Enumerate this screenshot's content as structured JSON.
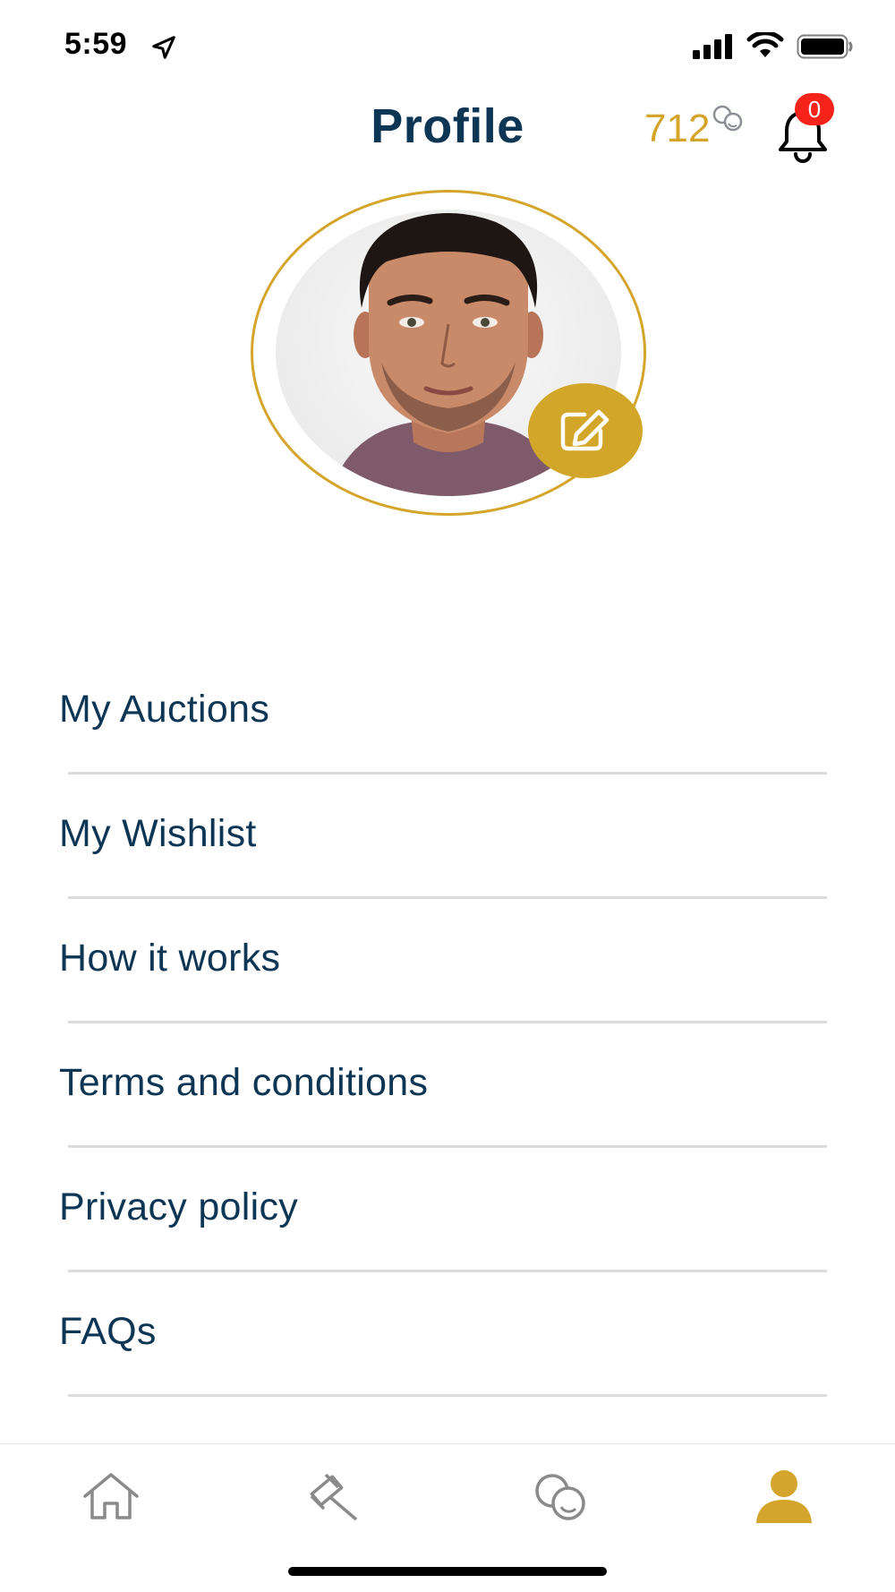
{
  "status_bar": {
    "time": "5:59"
  },
  "header": {
    "title": "Profile",
    "coins": "712",
    "notification_count": "0"
  },
  "colors": {
    "accent_gold": "#d4a52a",
    "title_navy": "#0d3554",
    "badge_red": "#f5231a",
    "tab_inactive": "#8a8a8a"
  },
  "menu": {
    "items": [
      {
        "label": "My Auctions"
      },
      {
        "label": "My Wishlist"
      },
      {
        "label": "How it works"
      },
      {
        "label": "Terms and conditions"
      },
      {
        "label": "Privacy policy"
      },
      {
        "label": "FAQs"
      }
    ]
  },
  "tab_bar": {
    "tabs": [
      {
        "icon": "home-icon",
        "active": false
      },
      {
        "icon": "gavel-icon",
        "active": false
      },
      {
        "icon": "coins-icon",
        "active": false
      },
      {
        "icon": "profile-icon",
        "active": true
      }
    ]
  }
}
